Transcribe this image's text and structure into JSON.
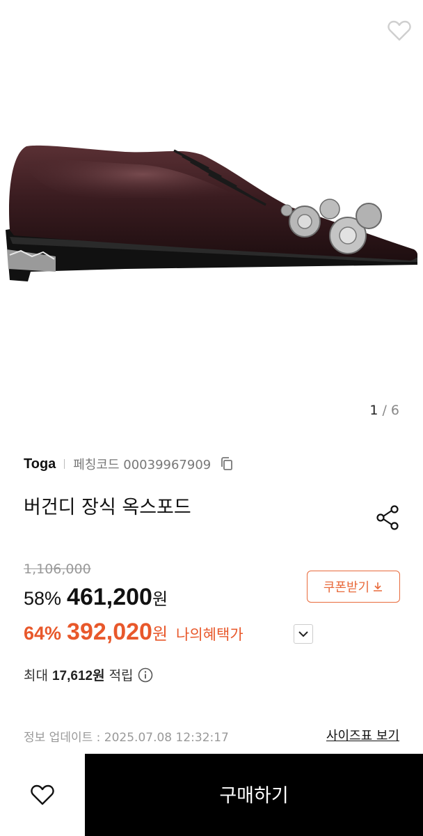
{
  "gallery": {
    "current": "1",
    "separator": "/",
    "total": "6"
  },
  "product": {
    "brand": "Toga",
    "code_label": "페칭코드 00039967909",
    "title": "버건디 장식 옥스포드"
  },
  "pricing": {
    "original": "1,106,000",
    "discount": "58%",
    "price": "461,200",
    "currency": "원",
    "coupon_label": "쿠폰받기",
    "benefit_discount": "64%",
    "benefit_price": "392,020",
    "benefit_label": "나의혜택가"
  },
  "points": {
    "prefix": "최대",
    "amount": "17,612원",
    "suffix": "적립"
  },
  "meta": {
    "updated": "정보 업데이트 : 2025.07.08 12:32:17",
    "size_chart_link": "사이즈표 보기"
  },
  "actions": {
    "buy_label": "구매하기"
  },
  "colors": {
    "accent": "#e8582b",
    "coupon": "#e86a3b",
    "buy_bg": "#000000"
  },
  "icons": [
    "heart-icon",
    "copy-icon",
    "share-icon",
    "download-icon",
    "chevron-down-icon",
    "info-icon"
  ]
}
